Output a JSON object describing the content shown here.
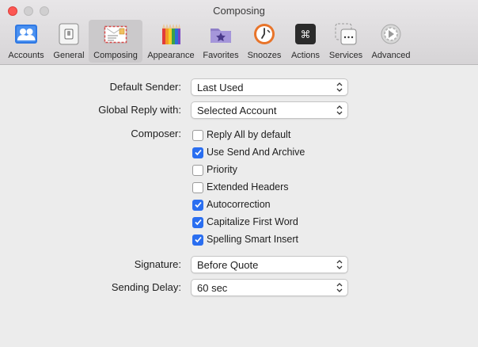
{
  "window": {
    "title": "Composing"
  },
  "toolbar": {
    "items": [
      {
        "label": "Accounts",
        "icon": "accounts-icon"
      },
      {
        "label": "General",
        "icon": "general-icon"
      },
      {
        "label": "Composing",
        "icon": "composing-icon",
        "selected": true
      },
      {
        "label": "Appearance",
        "icon": "appearance-icon"
      },
      {
        "label": "Favorites",
        "icon": "favorites-icon"
      },
      {
        "label": "Snoozes",
        "icon": "snoozes-icon"
      },
      {
        "label": "Actions",
        "icon": "actions-icon"
      },
      {
        "label": "Services",
        "icon": "services-icon"
      },
      {
        "label": "Advanced",
        "icon": "advanced-icon"
      }
    ]
  },
  "settings": {
    "default_sender": {
      "label": "Default Sender:",
      "value": "Last Used"
    },
    "global_reply": {
      "label": "Global Reply with:",
      "value": "Selected Account"
    },
    "composer": {
      "label": "Composer:",
      "options": [
        {
          "label": "Reply All by default",
          "checked": false
        },
        {
          "label": "Use Send And Archive",
          "checked": true
        },
        {
          "label": "Priority",
          "checked": false
        },
        {
          "label": "Extended Headers",
          "checked": false
        },
        {
          "label": "Autocorrection",
          "checked": true
        },
        {
          "label": "Capitalize First Word",
          "checked": true
        },
        {
          "label": "Spelling Smart Insert",
          "checked": true
        }
      ]
    },
    "signature": {
      "label": "Signature:",
      "value": "Before Quote"
    },
    "sending_delay": {
      "label": "Sending Delay:",
      "value": "60 sec"
    }
  },
  "colors": {
    "accent": "#2a6ef0",
    "close": "#fc5753",
    "window_bg": "#ececec"
  }
}
